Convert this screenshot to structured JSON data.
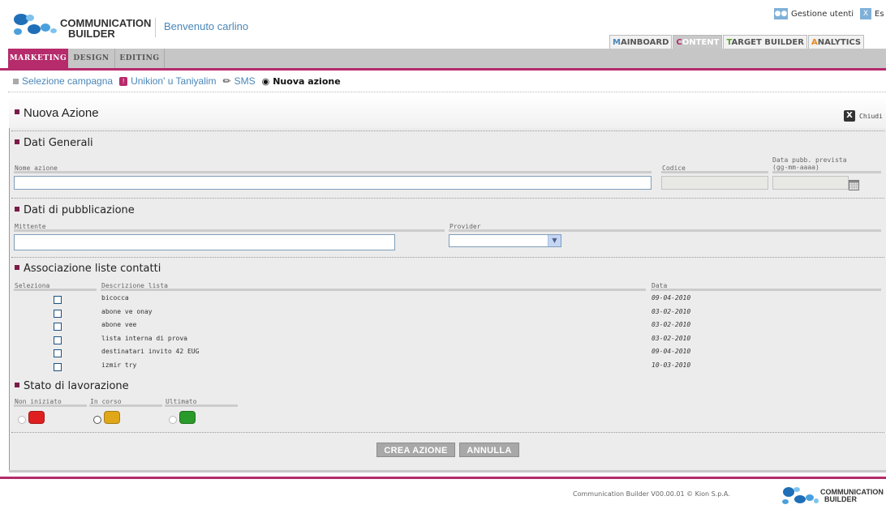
{
  "header": {
    "logo_line1": "COMMUNICATION",
    "logo_line2": "BUILDER",
    "welcome": "Benvenuto carlino",
    "user_mgmt": "Gestione utenti",
    "exit": "Es"
  },
  "main_tabs": [
    {
      "first": "M",
      "rest": "AINBOARD",
      "first_color": "#4a86b8",
      "active": false
    },
    {
      "first": "C",
      "rest": "ONTENT",
      "first_color": "#b52b6b",
      "active": true
    },
    {
      "first": "T",
      "rest": "ARGET BUILDER",
      "first_color": "#5aa02c",
      "active": false
    },
    {
      "first": "A",
      "rest": "NALYTICS",
      "first_color": "#e8891e",
      "active": false
    }
  ],
  "sub_tabs": [
    "MARKETING",
    "DESIGN",
    "EDITING"
  ],
  "breadcrumb": {
    "campaign": "Selezione campagna",
    "item": "Unikion' u Taniyalim",
    "channel": "SMS",
    "current": "Nuova azione"
  },
  "panel": {
    "title": "Nuova Azione",
    "close": "Chiudi"
  },
  "dati_generali": {
    "title": "Dati Generali",
    "nome_label": "Nome azione",
    "codice_label": "Codice",
    "data_label_1": "Data pubb. prevista",
    "data_label_2": "(gg-mm-aaaa)",
    "nome_value": "",
    "codice_value": "",
    "data_value": ""
  },
  "pubblicazione": {
    "title": "Dati di pubblicazione",
    "mittente_label": "Mittente",
    "provider_label": "Provider",
    "mittente_value": "",
    "provider_value": ""
  },
  "liste": {
    "title": "Associazione liste contatti",
    "col_seleziona": "Seleziona",
    "col_descrizione": "Descrizione lista",
    "col_data": "Data",
    "rows": [
      {
        "name": "bicocca",
        "date": "09-04-2010",
        "checked": false
      },
      {
        "name": "abone ve onay",
        "date": "03-02-2010",
        "checked": false
      },
      {
        "name": "abone vee",
        "date": "03-02-2010",
        "checked": false
      },
      {
        "name": "lista interna di prova",
        "date": "03-02-2010",
        "checked": false
      },
      {
        "name": "destinatari invito 42 EUG",
        "date": "09-04-2010",
        "checked": false
      },
      {
        "name": "izmir try",
        "date": "10-03-2010",
        "checked": false
      }
    ]
  },
  "stato": {
    "title": "Stato di lavorazione",
    "options": [
      {
        "label": "Non iniziato",
        "color": "#e02020"
      },
      {
        "label": "In corso",
        "color": "#e0a818"
      },
      {
        "label": "Ultimato",
        "color": "#2a9a2a"
      }
    ]
  },
  "buttons": {
    "create": "CREA AZIONE",
    "cancel": "ANNULLA"
  },
  "footer": {
    "text": "Communication Builder V00.00.01 © Kion S.p.A.",
    "logo_line1": "COMMUNICATION",
    "logo_line2": "BUILDER"
  }
}
